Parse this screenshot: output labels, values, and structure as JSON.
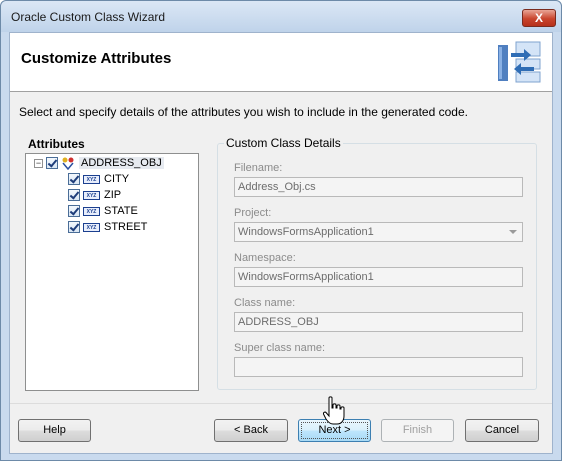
{
  "window": {
    "title": "Oracle Custom Class Wizard",
    "close_glyph": "X"
  },
  "header": {
    "title": "Customize Attributes",
    "graphic": "class-wizard-icon"
  },
  "instructions": "Select and specify details of the attributes you wish to include in the generated code.",
  "attributes": {
    "label": "Attributes",
    "root": {
      "name": "ADDRESS_OBJ",
      "checked": true,
      "expanded": true,
      "expander_glyph": "−"
    },
    "children": [
      {
        "name": "CITY",
        "checked": true,
        "type_icon": "XYZ"
      },
      {
        "name": "ZIP",
        "checked": true,
        "type_icon": "XYZ"
      },
      {
        "name": "STATE",
        "checked": true,
        "type_icon": "XYZ"
      },
      {
        "name": "STREET",
        "checked": true,
        "type_icon": "XYZ"
      }
    ]
  },
  "details": {
    "title": "Custom Class Details",
    "filename": {
      "label": "Filename:",
      "value": "Address_Obj.cs"
    },
    "project": {
      "label": "Project:",
      "value": "WindowsFormsApplication1"
    },
    "namespace": {
      "label": "Namespace:",
      "value": "WindowsFormsApplication1"
    },
    "class_name": {
      "label": "Class name:",
      "value": "ADDRESS_OBJ"
    },
    "super_class": {
      "label": "Super class name:",
      "value": ""
    }
  },
  "buttons": {
    "help": "Help",
    "back": "< Back",
    "next": "Next >",
    "finish": "Finish",
    "cancel": "Cancel"
  },
  "colors": {
    "accent": "#3c7fb1",
    "close": "#c9452d",
    "titlebar": "#c9daee"
  }
}
